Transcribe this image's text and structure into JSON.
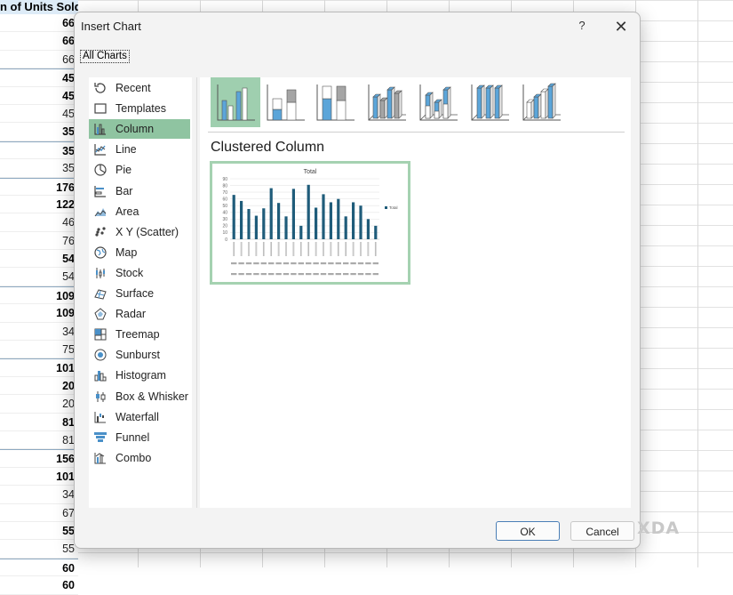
{
  "sheet": {
    "header": "n of Units Sold",
    "rows": [
      {
        "v": "66",
        "b": true,
        "sep": false
      },
      {
        "v": "66",
        "b": true,
        "sep": false
      },
      {
        "v": "66",
        "b": false,
        "sep": false
      },
      {
        "v": "45",
        "b": true,
        "sep": true
      },
      {
        "v": "45",
        "b": true,
        "sep": false
      },
      {
        "v": "45",
        "b": false,
        "sep": false
      },
      {
        "v": "35",
        "b": true,
        "sep": false
      },
      {
        "v": "35",
        "b": true,
        "sep": true
      },
      {
        "v": "35",
        "b": false,
        "sep": false
      },
      {
        "v": "176",
        "b": true,
        "sep": true
      },
      {
        "v": "122",
        "b": true,
        "sep": false
      },
      {
        "v": "46",
        "b": false,
        "sep": false
      },
      {
        "v": "76",
        "b": false,
        "sep": false
      },
      {
        "v": "54",
        "b": true,
        "sep": false
      },
      {
        "v": "54",
        "b": false,
        "sep": false
      },
      {
        "v": "109",
        "b": true,
        "sep": true
      },
      {
        "v": "109",
        "b": true,
        "sep": false
      },
      {
        "v": "34",
        "b": false,
        "sep": false
      },
      {
        "v": "75",
        "b": false,
        "sep": false
      },
      {
        "v": "101",
        "b": true,
        "sep": true
      },
      {
        "v": "20",
        "b": true,
        "sep": false
      },
      {
        "v": "20",
        "b": false,
        "sep": false
      },
      {
        "v": "81",
        "b": true,
        "sep": false
      },
      {
        "v": "81",
        "b": false,
        "sep": false
      },
      {
        "v": "156",
        "b": true,
        "sep": true
      },
      {
        "v": "101",
        "b": true,
        "sep": false
      },
      {
        "v": "34",
        "b": false,
        "sep": false
      },
      {
        "v": "67",
        "b": false,
        "sep": false
      },
      {
        "v": "55",
        "b": true,
        "sep": false
      },
      {
        "v": "55",
        "b": false,
        "sep": false
      },
      {
        "v": "60",
        "b": true,
        "sep": true
      },
      {
        "v": "60",
        "b": true,
        "sep": false
      }
    ]
  },
  "dialog": {
    "title": "Insert Chart",
    "help": "?",
    "close": "✕",
    "tab": "All Charts",
    "categories": [
      {
        "label": "Recent",
        "icon": "recent-icon"
      },
      {
        "label": "Templates",
        "icon": "templates-icon"
      },
      {
        "label": "Column",
        "icon": "column-chart-icon",
        "selected": true
      },
      {
        "label": "Line",
        "icon": "line-chart-icon"
      },
      {
        "label": "Pie",
        "icon": "pie-chart-icon"
      },
      {
        "label": "Bar",
        "icon": "bar-chart-icon"
      },
      {
        "label": "Area",
        "icon": "area-chart-icon"
      },
      {
        "label": "X Y (Scatter)",
        "icon": "scatter-chart-icon"
      },
      {
        "label": "Map",
        "icon": "map-chart-icon"
      },
      {
        "label": "Stock",
        "icon": "stock-chart-icon"
      },
      {
        "label": "Surface",
        "icon": "surface-chart-icon"
      },
      {
        "label": "Radar",
        "icon": "radar-chart-icon"
      },
      {
        "label": "Treemap",
        "icon": "treemap-chart-icon"
      },
      {
        "label": "Sunburst",
        "icon": "sunburst-chart-icon"
      },
      {
        "label": "Histogram",
        "icon": "histogram-chart-icon"
      },
      {
        "label": "Box & Whisker",
        "icon": "box-whisker-chart-icon"
      },
      {
        "label": "Waterfall",
        "icon": "waterfall-chart-icon"
      },
      {
        "label": "Funnel",
        "icon": "funnel-chart-icon"
      },
      {
        "label": "Combo",
        "icon": "combo-chart-icon"
      }
    ],
    "subtypes": [
      {
        "name": "clustered-column",
        "selected": true
      },
      {
        "name": "stacked-column"
      },
      {
        "name": "100-stacked-column"
      },
      {
        "name": "3d-clustered-column"
      },
      {
        "name": "3d-stacked-column"
      },
      {
        "name": "3d-100-stacked-column"
      },
      {
        "name": "3d-column"
      }
    ],
    "selected_subtype": "Clustered Column",
    "ok": "OK",
    "cancel": "Cancel"
  },
  "colors": {
    "accent": "#8fc4a1",
    "preview_border": "#a5d2b1",
    "bar": "#1f5c7a",
    "icon_blue": "#4a90c8"
  },
  "chart_data": {
    "type": "bar",
    "title": "Total",
    "legend": [
      "Total"
    ],
    "legend_position": "right",
    "yticks": [
      "0",
      "10",
      "20",
      "30",
      "40",
      "50",
      "60",
      "70",
      "80",
      "90"
    ],
    "ylim": [
      0,
      90
    ],
    "values": [
      66,
      57,
      45,
      35,
      46,
      76,
      54,
      34,
      75,
      20,
      81,
      47,
      67,
      55,
      60,
      34,
      55,
      50,
      30,
      20
    ]
  },
  "watermark": "XDA"
}
